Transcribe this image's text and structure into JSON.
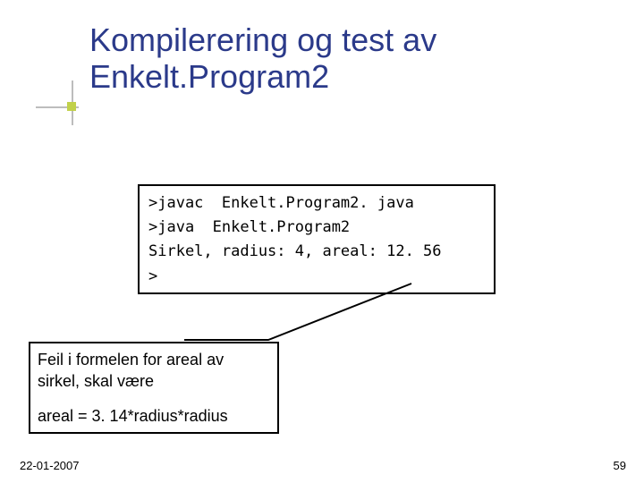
{
  "title_line1": "Kompilerering og test av",
  "title_line2": "Enkelt.Program2",
  "code": {
    "l1": ">javac  Enkelt.Program2. java",
    "l2": ">java  Enkelt.Program2",
    "l3": "Sirkel, radius: 4, areal: 12. 56",
    "l4": ">"
  },
  "callout": {
    "line1": "Feil i formelen for areal av",
    "line2": "sirkel, skal være",
    "line3": "areal = 3. 14*radius*radius"
  },
  "footer": {
    "date": "22-01-2007",
    "page": "59"
  }
}
